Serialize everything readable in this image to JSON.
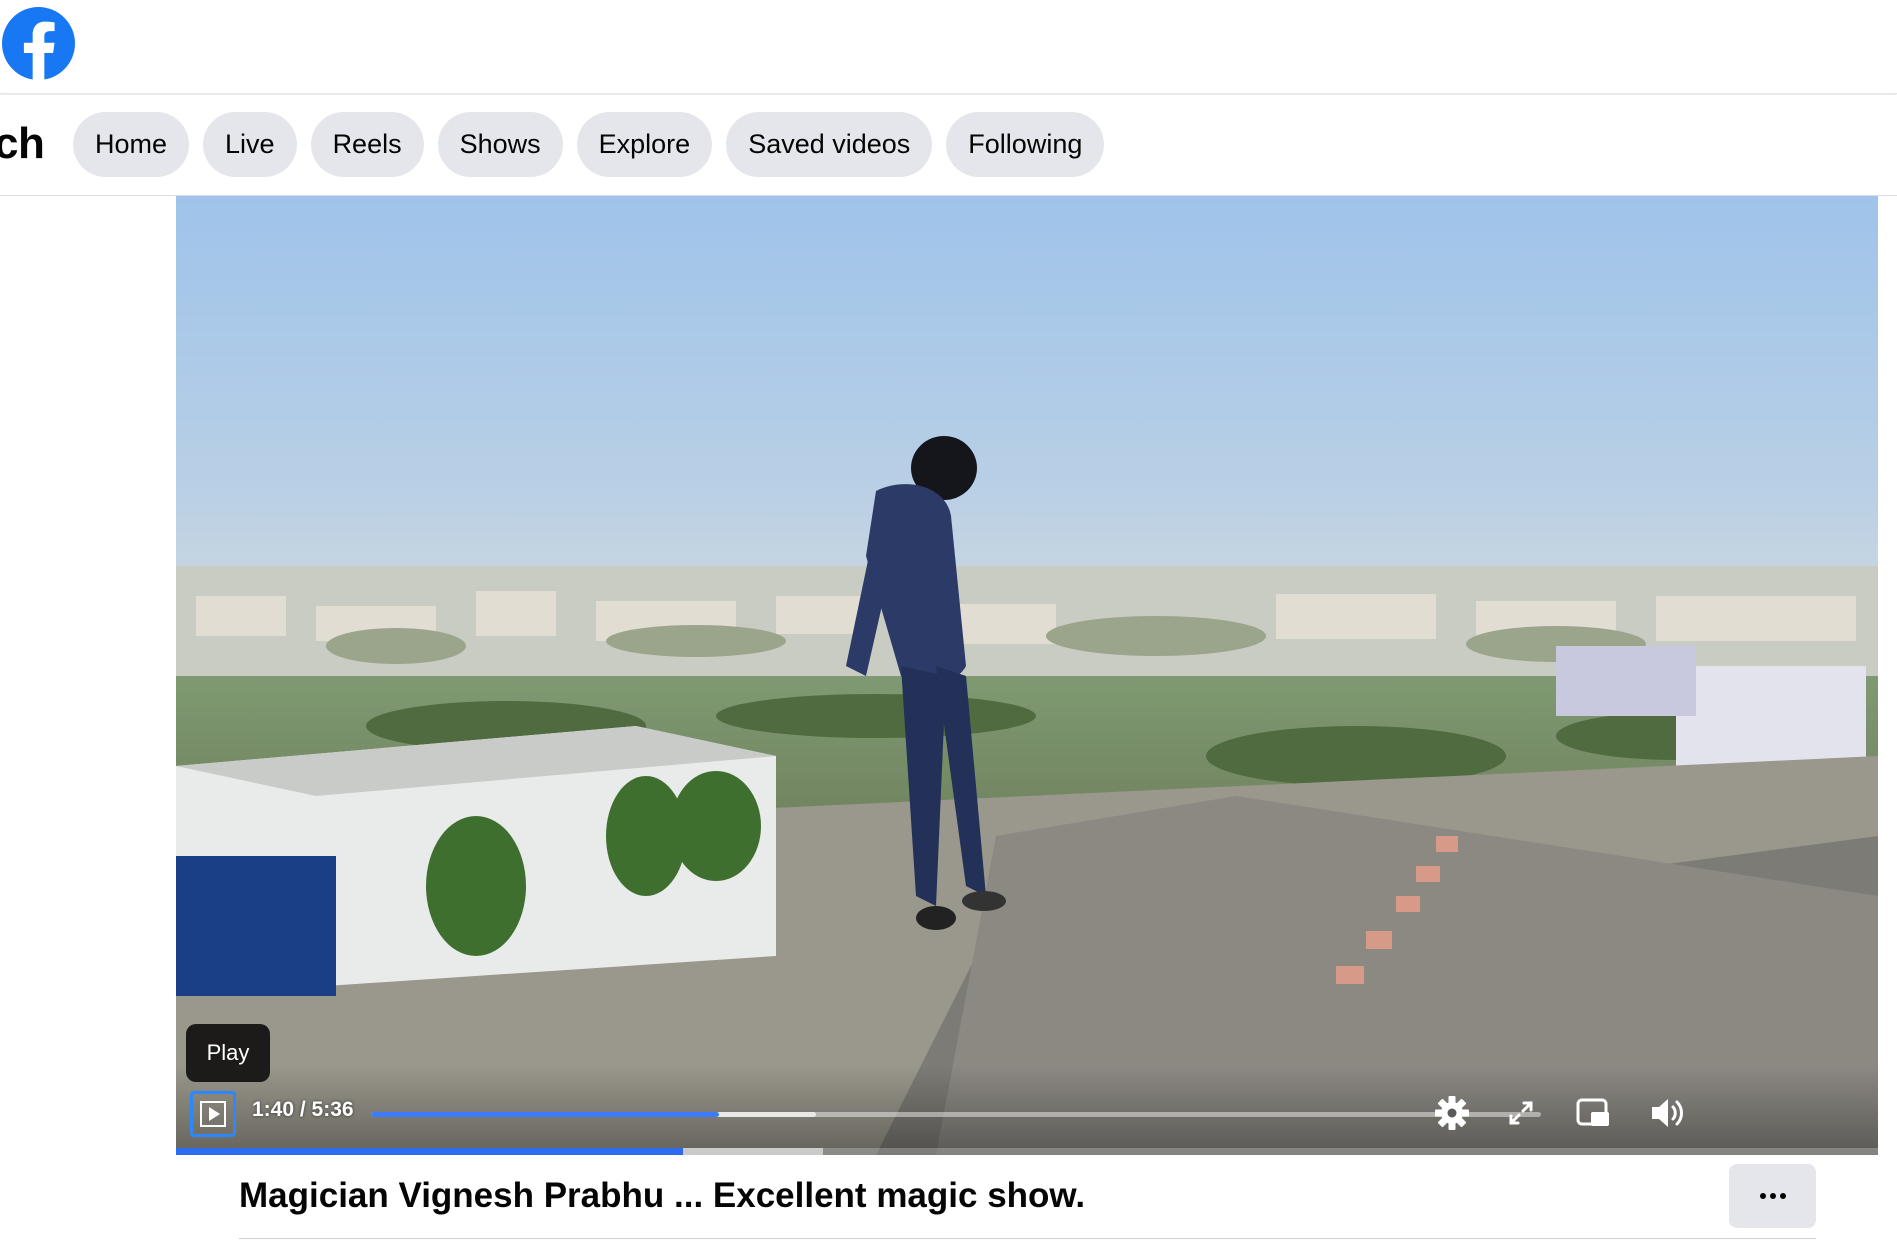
{
  "app": {
    "brand_icon": "facebook-icon",
    "brand_color": "#1877f2"
  },
  "watch_nav": {
    "title": "ch",
    "tabs": [
      {
        "label": "Home"
      },
      {
        "label": "Live"
      },
      {
        "label": "Reels"
      },
      {
        "label": "Shows"
      },
      {
        "label": "Explore"
      },
      {
        "label": "Saved videos"
      },
      {
        "label": "Following"
      }
    ]
  },
  "video": {
    "tooltip": "Play",
    "time_display": "1:40 / 5:36",
    "current_seconds": 100,
    "duration_seconds": 336,
    "buffered_fraction": 0.38,
    "progress_color": "#3c7bff",
    "controls": {
      "play_icon": "play-icon",
      "settings_icon": "gear-icon",
      "fullscreen_icon": "expand-icon",
      "pip_icon": "picture-in-picture-icon",
      "volume_icon": "volume-icon"
    }
  },
  "post": {
    "title": "Magician Vignesh Prabhu ... Excellent magic show.",
    "more_label": "···"
  }
}
